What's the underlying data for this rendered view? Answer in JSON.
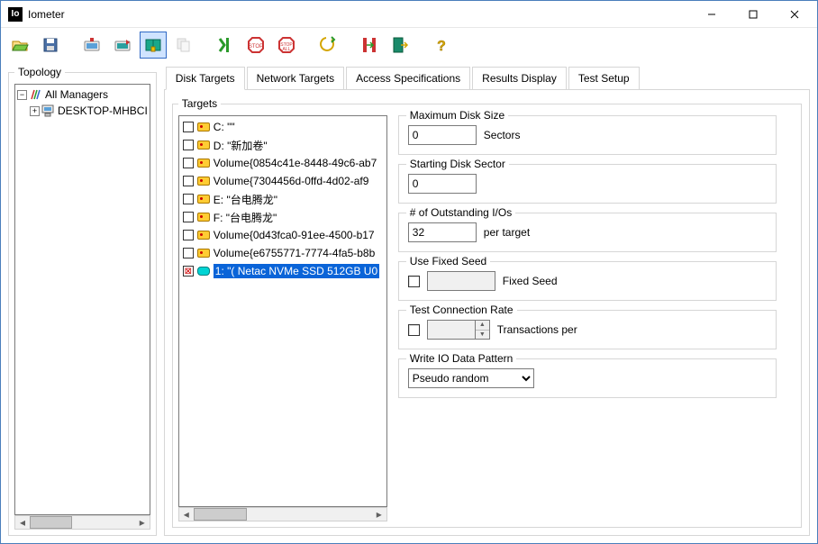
{
  "window": {
    "title": "Iometer",
    "icon_text": "Io"
  },
  "toolbar": {
    "buttons": [
      "open",
      "save",
      "import",
      "export",
      "disk-targets",
      "copy",
      "start",
      "stop",
      "stop-all",
      "reset",
      "cycle",
      "exit",
      "help"
    ]
  },
  "topology": {
    "title": "Topology",
    "root": "All Managers",
    "nodes": [
      "DESKTOP-MHBCI"
    ]
  },
  "tabs": [
    "Disk Targets",
    "Network Targets",
    "Access Specifications",
    "Results Display",
    "Test Setup"
  ],
  "active_tab": 0,
  "targets_group_label": "Targets",
  "targets": [
    {
      "label": "C: \"\"",
      "type": "disk",
      "selected": false
    },
    {
      "label": "D: \"新加卷\"",
      "type": "disk",
      "selected": false
    },
    {
      "label": "Volume{0854c41e-8448-49c6-ab7",
      "type": "disk",
      "selected": false
    },
    {
      "label": "Volume{7304456d-0ffd-4d02-af9",
      "type": "disk",
      "selected": false
    },
    {
      "label": "E: \"台电腾龙\"",
      "type": "disk",
      "selected": false
    },
    {
      "label": "F: \"台电腾龙\"",
      "type": "disk",
      "selected": false
    },
    {
      "label": "Volume{0d43fca0-91ee-4500-b17",
      "type": "disk",
      "selected": false
    },
    {
      "label": "Volume{e6755771-7774-4fa5-b8b",
      "type": "disk",
      "selected": false
    },
    {
      "label": "1: \"( Netac NVMe SSD 512GB U0",
      "type": "phys",
      "selected": true,
      "checked": true
    }
  ],
  "controls": {
    "max_disk_size": {
      "label": "Maximum Disk Size",
      "value": "0",
      "unit": "Sectors"
    },
    "starting_sector": {
      "label": "Starting Disk Sector",
      "value": "0"
    },
    "outstanding_ios": {
      "label": "# of Outstanding I/Os",
      "value": "32",
      "unit": "per target"
    },
    "fixed_seed": {
      "label": "Use Fixed Seed",
      "field_label": "Fixed Seed",
      "checked": false,
      "value": ""
    },
    "conn_rate": {
      "label": "Test Connection Rate",
      "field_label": "Transactions per",
      "checked": false,
      "value": ""
    },
    "write_pattern": {
      "label": "Write IO Data Pattern",
      "value": "Pseudo random"
    }
  }
}
